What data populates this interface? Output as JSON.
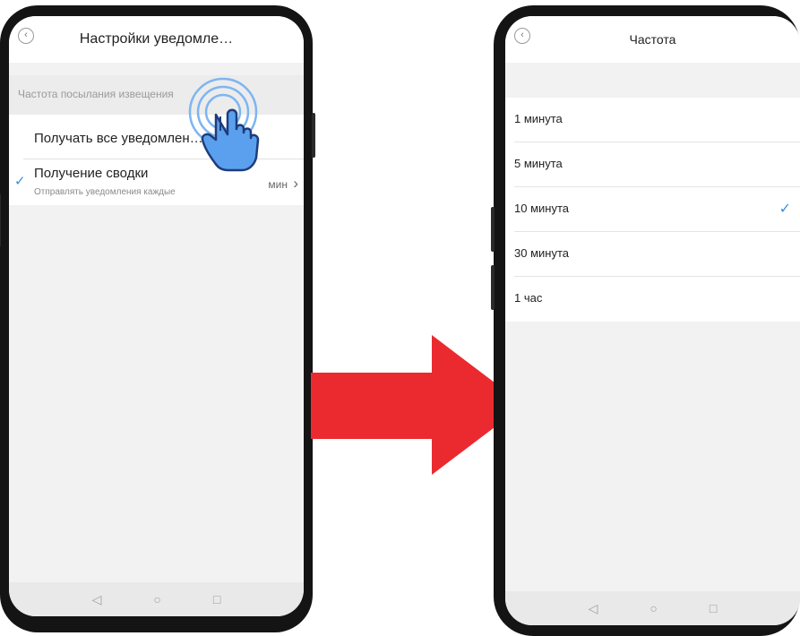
{
  "left_phone": {
    "title": "Настройки уведомле…",
    "section_label": "Частота посылания извещения",
    "row1_label": "Получать все уведомлен…",
    "row2_title": "Получение сводки",
    "row2_subtitle": "Отправлять уведомления каждые",
    "row2_value": "мин",
    "row2_chevron": "›",
    "check": "✓",
    "back_icon": "‹"
  },
  "right_phone": {
    "title": "Частота",
    "back_icon": "‹",
    "options": [
      {
        "label": "1 минута",
        "selected": false
      },
      {
        "label": "5 минута",
        "selected": false
      },
      {
        "label": "10 минута",
        "selected": true
      },
      {
        "label": "30 минута",
        "selected": false
      },
      {
        "label": "1 час",
        "selected": false
      }
    ],
    "check": "✓"
  },
  "nav": {
    "back": "◁",
    "home": "○",
    "recent": "□"
  },
  "colors": {
    "arrow": "#ea2a2f",
    "accent": "#3a8fdc",
    "hand": "#5aa0ee"
  }
}
